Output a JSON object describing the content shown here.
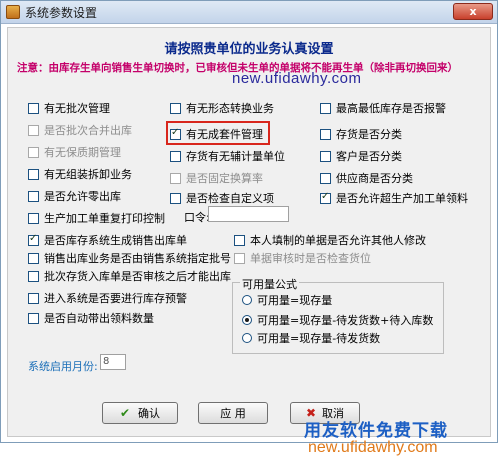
{
  "window": {
    "title": "系统参数设置",
    "close_label": "x"
  },
  "heading": "请按照贵单位的业务认真设置",
  "note": "注意：由库存生单向销售生单切换时，已审核但未生单的单据将不能再生单（除非再切换回来）",
  "watermark_top": "new.ufidawhy.com",
  "col1": [
    {
      "label": "有无批次管理",
      "checked": false,
      "disabled": false
    },
    {
      "label": "是否批次合并出库",
      "checked": false,
      "disabled": true
    },
    {
      "label": "有无保质期管理",
      "checked": false,
      "disabled": true
    },
    {
      "label": "有无组装拆卸业务",
      "checked": false,
      "disabled": false
    },
    {
      "label": "是否允许零出库",
      "checked": false,
      "disabled": false
    },
    {
      "label": "生产加工单重复打印控制",
      "checked": false,
      "disabled": false
    },
    {
      "label": "是否库存系统生成销售出库单",
      "checked": true,
      "disabled": false
    },
    {
      "label": "销售出库业务是否由销售系统指定批号",
      "checked": false,
      "disabled": false
    },
    {
      "label": "批次存货入库单是否审核之后才能出库",
      "checked": false,
      "disabled": false
    },
    {
      "label": "进入系统是否要进行库存预警",
      "checked": false,
      "disabled": false
    },
    {
      "label": "是否自动带出领料数量",
      "checked": false,
      "disabled": false
    }
  ],
  "col2": [
    {
      "label": "有无形态转换业务",
      "checked": false,
      "disabled": false
    },
    {
      "label": "有无成套件管理",
      "checked": true,
      "disabled": false
    },
    {
      "label": "存货有无辅计量单位",
      "checked": false,
      "disabled": false
    },
    {
      "label": "是否固定换算率",
      "checked": false,
      "disabled": true
    },
    {
      "label": "是否检查自定义项",
      "checked": false,
      "disabled": false
    },
    {
      "label": "本人填制的单据是否允许其他人修改",
      "checked": false,
      "disabled": false
    },
    {
      "label": "单据审核时是否检查货位",
      "checked": false,
      "disabled": true
    }
  ],
  "col3": [
    {
      "label": "最高最低库存是否报警",
      "checked": false,
      "disabled": false
    },
    {
      "label": "存货是否分类",
      "checked": false,
      "disabled": false
    },
    {
      "label": "客户是否分类",
      "checked": false,
      "disabled": false
    },
    {
      "label": "供应商是否分类",
      "checked": false,
      "disabled": false
    },
    {
      "label": "是否允许超生产加工单领料",
      "checked": true,
      "disabled": false
    }
  ],
  "kouling_label": "口令:",
  "available_formula": {
    "title": "可用量公式",
    "options": [
      {
        "label": "可用量=现存量",
        "selected": false
      },
      {
        "label": "可用量=现存量-待发货数+待入库数",
        "selected": true
      },
      {
        "label": "可用量=现存量-待发货数",
        "selected": false
      }
    ]
  },
  "start_month": {
    "label": "系统启用月份:",
    "value": "8"
  },
  "buttons": {
    "ok": "确认",
    "apply": "应 用",
    "cancel": "取消"
  },
  "watermark_brand": "用友软件免费下载",
  "watermark_url": "new.ufidawhy.com"
}
